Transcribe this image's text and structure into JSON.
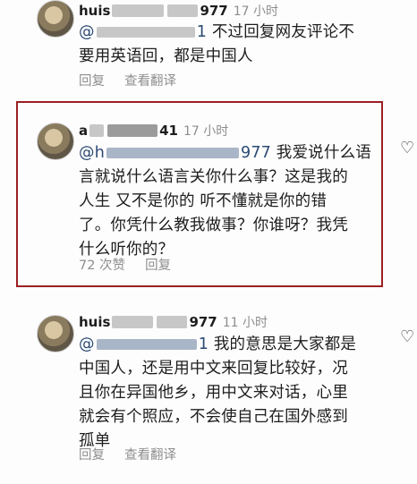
{
  "comments": [
    {
      "username_prefix": "huis",
      "username_suffix": "977",
      "time": "17 小时",
      "mention_prefix": "@",
      "mention_suffix": "1",
      "lines": [
        "不过回复网友评论不",
        "要用英语回，都是中国人"
      ],
      "actions": [
        "回复",
        "查看翻译"
      ]
    },
    {
      "username_prefix": "a",
      "username_suffix": "41",
      "time": "17 小时",
      "mention_prefix": "@h",
      "mention_suffix": "977",
      "lines": [
        "我爱说什么语",
        "言就说什么语言关你什么事？这是我的",
        "人生 又不是你的 听不懂就是你的错",
        "了。你凭什么教我做事？你谁呀？我凭",
        "什么听你的？"
      ],
      "actions": [
        "72 次赞",
        "回复"
      ]
    },
    {
      "username_prefix": "huis",
      "username_suffix": "977",
      "time": "11 小时",
      "mention_prefix": "@",
      "mention_suffix": "1",
      "lines": [
        "我的意思是大家都是",
        "中国人，还是用中文来回复比较好，况",
        "且你在异国他乡，用中文来对话，心里",
        "就会有个照应，不会使自己在国外感到",
        "孤单"
      ],
      "actions": [
        "回复",
        "查看翻译"
      ]
    }
  ],
  "icons": {
    "like": "heart-outline-icon"
  },
  "colors": {
    "highlight_border": "#9b2024",
    "mention": "#2b4a74",
    "meta": "#8e8e8e"
  }
}
